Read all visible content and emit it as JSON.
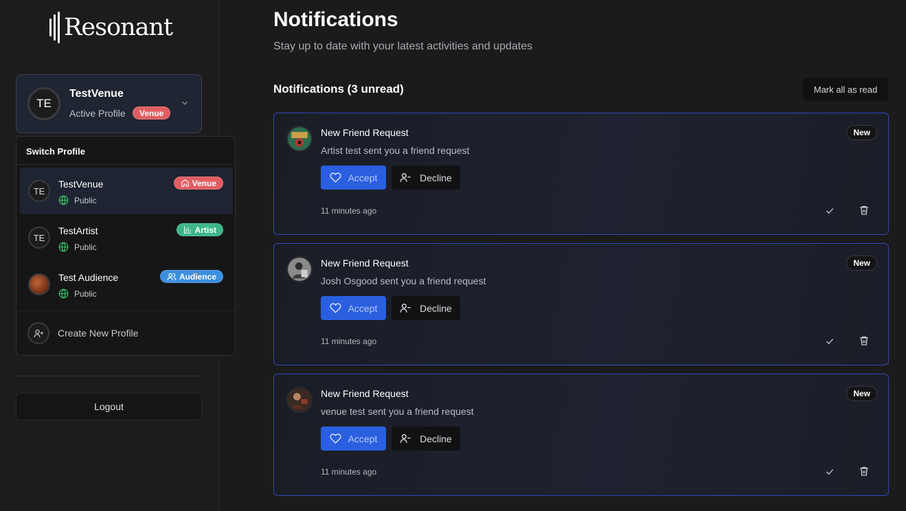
{
  "app": {
    "logo_text": "Resonant"
  },
  "active_profile": {
    "initials": "TE",
    "name": "TestVenue",
    "subtitle": "Active Profile",
    "badge": "Venue"
  },
  "switcher": {
    "title": "Switch Profile",
    "profiles": [
      {
        "initials": "TE",
        "name": "TestVenue",
        "visibility": "Public",
        "badge": "Venue",
        "badge_icon": "home-icon",
        "active": true
      },
      {
        "initials": "TE",
        "name": "TestArtist",
        "visibility": "Public",
        "badge": "Artist",
        "badge_icon": "bar-chart-icon",
        "active": false
      },
      {
        "initials": "",
        "name": "Test Audience",
        "visibility": "Public",
        "badge": "Audience",
        "badge_icon": "users-icon",
        "active": false
      }
    ],
    "create_label": "Create New Profile"
  },
  "sidebar": {
    "logout_label": "Logout"
  },
  "page": {
    "title": "Notifications",
    "subtitle": "Stay up to date with your latest activities and updates",
    "section_title": "Notifications (3 unread)",
    "mark_all_label": "Mark all as read"
  },
  "notifications": [
    {
      "title": "New Friend Request",
      "message": "Artist test sent you a friend request",
      "badge": "New",
      "accept_label": "Accept",
      "decline_label": "Decline",
      "time": "11 minutes ago"
    },
    {
      "title": "New Friend Request",
      "message": "Josh Osgood sent you a friend request",
      "badge": "New",
      "accept_label": "Accept",
      "decline_label": "Decline",
      "time": "11 minutes ago"
    },
    {
      "title": "New Friend Request",
      "message": "venue test sent you a friend request",
      "badge": "New",
      "accept_label": "Accept",
      "decline_label": "Decline",
      "time": "11 minutes ago"
    }
  ],
  "colors": {
    "venue": "#e05d61",
    "artist": "#3fb58a",
    "audience": "#3d8fe0",
    "accent": "#2a5fe0",
    "public_globe": "#3fbf6a"
  }
}
